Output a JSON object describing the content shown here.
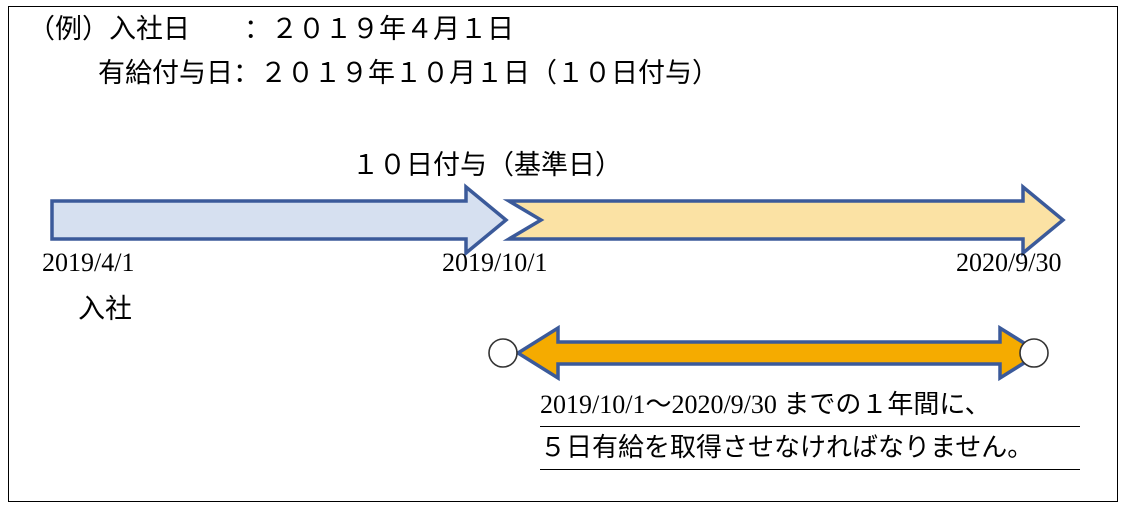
{
  "header": {
    "line1": "（例）入社日　　：２０１９年４月１日",
    "line2": "有給付与日：２０１９年１０月１日（１０日付与）"
  },
  "diagram": {
    "grant_label": "１０日付与（基準日）",
    "timeline": {
      "first_period": {
        "name": "pre-grant-period",
        "fill_color": "#d6e0f0",
        "stroke_color": "#3b5a9a",
        "start_label": "2019/4/1",
        "end_label": "2019/10/1"
      },
      "second_period": {
        "name": "grant-year-period",
        "fill_color": "#fbe2a4",
        "stroke_color": "#3b5a9a",
        "start_label": "2019/10/1",
        "end_label": "2020/9/30"
      }
    },
    "join_label": "入社",
    "dates": {
      "start": "2019/4/1",
      "middle": "2019/10/1",
      "end": "2020/9/30"
    },
    "obligation_arrow": {
      "name": "five-day-obligation-span",
      "fill_color": "#f5ab00",
      "stroke_color": "#3b5a9a",
      "endpoint_marker_fill": "#ffffff",
      "endpoint_marker_stroke": "#333333"
    },
    "caption_lines": [
      "2019/10/1～2020/9/30 までの１年間に、",
      "５日有給を取得させなければなりません。"
    ]
  },
  "colors": {
    "frame": "#000000",
    "text": "#000000",
    "blue_stroke": "#3b5a9a",
    "light_blue_fill": "#d6e0f0",
    "light_yellow_fill": "#fbe2a4",
    "gold_fill": "#f5ab00"
  }
}
